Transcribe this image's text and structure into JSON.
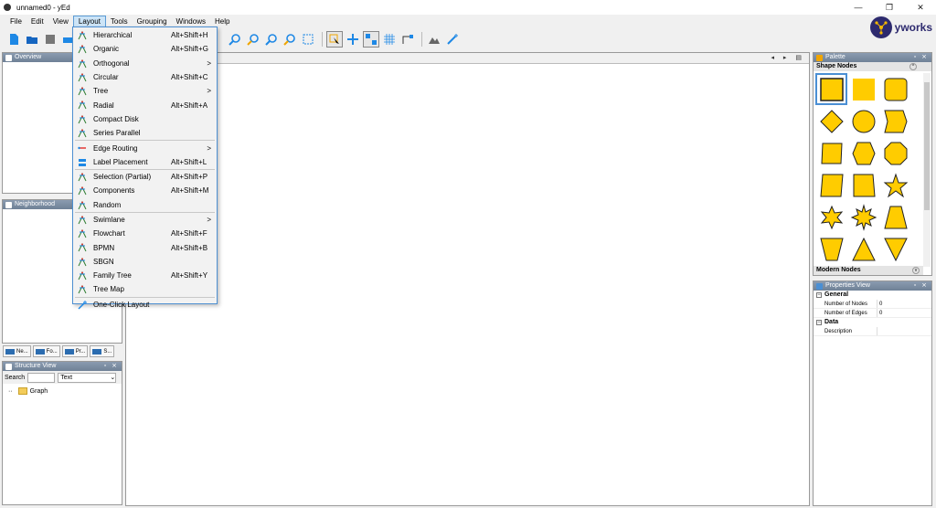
{
  "window": {
    "title": "unnamed0 - yEd",
    "minimize": "—",
    "maximize": "❐",
    "close": "✕"
  },
  "menubar": [
    "File",
    "Edit",
    "View",
    "Layout",
    "Tools",
    "Grouping",
    "Windows",
    "Help"
  ],
  "brand": "yworks",
  "colors": {
    "accent": "#4d8fd1",
    "node_fill": "#ffcc00",
    "node_stroke": "#333333",
    "panel_header": "#7a8ba0",
    "brand": "#2d2a6e"
  },
  "layout_menu": {
    "items": [
      {
        "label": "Hierarchical",
        "shortcut": "Alt+Shift+H",
        "icon": "layout-icon"
      },
      {
        "label": "Organic",
        "shortcut": "Alt+Shift+G",
        "icon": "layout-icon"
      },
      {
        "label": "Orthogonal",
        "submenu": ">",
        "icon": "layout-icon"
      },
      {
        "label": "Circular",
        "shortcut": "Alt+Shift+C",
        "icon": "layout-icon"
      },
      {
        "label": "Tree",
        "submenu": ">",
        "icon": "layout-icon"
      },
      {
        "label": "Radial",
        "shortcut": "Alt+Shift+A",
        "icon": "layout-icon"
      },
      {
        "label": "Compact Disk",
        "icon": "layout-icon"
      },
      {
        "label": "Series Parallel",
        "icon": "layout-icon"
      },
      {
        "separator": true
      },
      {
        "label": "Edge Routing",
        "submenu": ">",
        "icon": "edge-routing-icon"
      },
      {
        "label": "Label Placement",
        "shortcut": "Alt+Shift+L",
        "icon": "label-placement-icon"
      },
      {
        "separator": true
      },
      {
        "label": "Selection (Partial)",
        "shortcut": "Alt+Shift+P",
        "icon": "layout-icon"
      },
      {
        "label": "Components",
        "shortcut": "Alt+Shift+M",
        "icon": "layout-icon"
      },
      {
        "label": "Random",
        "icon": "layout-icon"
      },
      {
        "separator": true
      },
      {
        "label": "Swimlane",
        "submenu": ">",
        "icon": "layout-icon"
      },
      {
        "label": "Flowchart",
        "shortcut": "Alt+Shift+F",
        "icon": "layout-icon"
      },
      {
        "label": "BPMN",
        "shortcut": "Alt+Shift+B",
        "icon": "layout-icon"
      },
      {
        "label": "SBGN",
        "icon": "layout-icon"
      },
      {
        "label": "Family Tree",
        "shortcut": "Alt+Shift+Y",
        "icon": "layout-icon"
      },
      {
        "label": "Tree Map",
        "icon": "layout-icon"
      },
      {
        "separator": true
      },
      {
        "label": "One-Click Layout",
        "icon": "magic-wand-icon"
      }
    ]
  },
  "panels": {
    "overview": {
      "title": "Overview"
    },
    "neighborhood": {
      "title": "Neighborhood"
    },
    "bottom_tabs": [
      "Ne...",
      "Fo...",
      "Pr...",
      "S..."
    ],
    "structure": {
      "title": "Structure View",
      "search_label": "Search",
      "search_value": "",
      "filter_value": "Text",
      "root_label": "Graph"
    },
    "palette": {
      "title": "Palette",
      "section1": "Shape Nodes",
      "section2": "Modern Nodes"
    },
    "properties": {
      "title": "Properties View",
      "group1": "General",
      "rows1": [
        {
          "key": "Number of Nodes",
          "value": "0"
        },
        {
          "key": "Number of Edges",
          "value": "0"
        }
      ],
      "group2": "Data",
      "rows2": [
        {
          "key": "Description",
          "value": ""
        }
      ]
    }
  },
  "shapes": [
    "rectangle-selected",
    "rectangle",
    "rounded-rectangle",
    "diamond",
    "ellipse",
    "banner",
    "parallelogram",
    "hexagon",
    "octagon",
    "trapezoid-slanted",
    "square",
    "star5",
    "star6",
    "star8",
    "trapezoid",
    "trapezoid-inverted",
    "triangle",
    "triangle-down"
  ]
}
